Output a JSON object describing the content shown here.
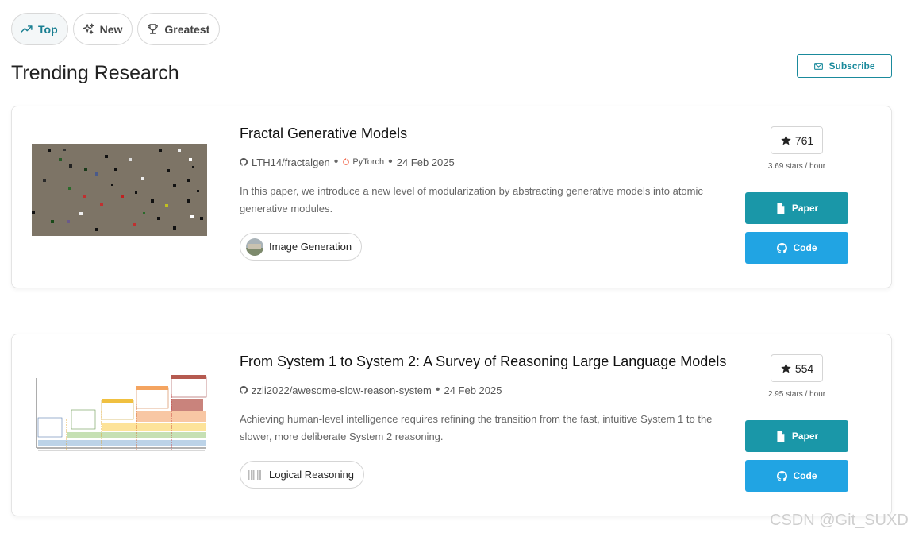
{
  "tabs": [
    {
      "label": "Top",
      "icon": "trending-up-icon",
      "active": true
    },
    {
      "label": "New",
      "icon": "sparkles-icon",
      "active": false
    },
    {
      "label": "Greatest",
      "icon": "trophy-icon",
      "active": false
    }
  ],
  "page_title": "Trending Research",
  "subscribe_label": "Subscribe",
  "papers": [
    {
      "title": "Fractal Generative Models",
      "repo": "LTH14/fractalgen",
      "framework": "PyTorch",
      "date": "24 Feb 2025",
      "abstract": "In this paper, we introduce a new level of modularization by abstracting generative models into atomic generative modules.",
      "task": "Image Generation",
      "stars": "761",
      "stars_rate": "3.69 stars / hour",
      "paper_label": "Paper",
      "code_label": "Code"
    },
    {
      "title": "From System 1 to System 2: A Survey of Reasoning Large Language Models",
      "repo": "zzli2022/awesome-slow-reason-system",
      "date": "24 Feb 2025",
      "abstract": "Achieving human-level intelligence requires refining the transition from the fast, intuitive System 1 to the slower, more deliberate System 2 reasoning.",
      "task": "Logical Reasoning",
      "stars": "554",
      "stars_rate": "2.95 stars / hour",
      "paper_label": "Paper",
      "code_label": "Code"
    }
  ],
  "watermark": "CSDN @Git_SUXD",
  "colors": {
    "accent": "#1a8a9c",
    "paper_button": "#1a97a8",
    "code_button": "#21a4e3",
    "pytorch": "#ee4c2c"
  }
}
